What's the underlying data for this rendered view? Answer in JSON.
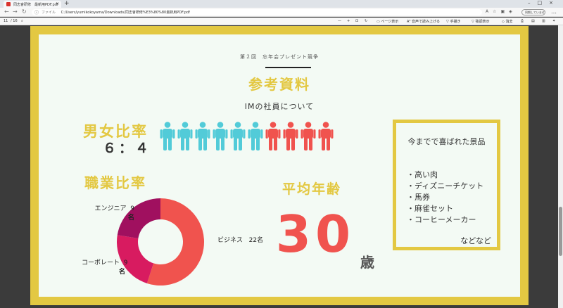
{
  "browser": {
    "tab_title": "同志會研修　最新用PDF.pdf",
    "tab_close": "×",
    "new_tab": "+",
    "window_controls": "–□×",
    "nav_back": "←",
    "nav_forward": "→",
    "nav_reload": "↻",
    "url_label": "ファイル",
    "url": "C:/Users/yumikokoyama/Downloads/同志會研修%E3%80%80最新用PDF.pdf",
    "profile_label": "同期していません",
    "more": "…"
  },
  "pdf_toolbar": {
    "page_current": "11",
    "page_total": "/ 16",
    "zoom_minus": "—",
    "zoom_plus": "+",
    "page_view": "ページ表示",
    "read_aloud": "音声で読み上げる",
    "draw": "手描き",
    "highlight": "強調表示",
    "erase": "消去"
  },
  "slide": {
    "subtitle": "第２回　忘年会プレゼント競争",
    "title": "参考資料",
    "intro": "IMの社員について",
    "gender": {
      "title": "男女比率",
      "ratio": "６：４",
      "male_count": 6,
      "female_count": 4,
      "male_color": "#52cbd8",
      "female_color": "#f0534e"
    },
    "occupation": {
      "title": "職業比率",
      "segments": [
        {
          "label": "ビジネス",
          "count_label": "22名",
          "value": 22,
          "color": "#f0534e"
        },
        {
          "label": "コーポレート",
          "count_label": "9",
          "unit": "名",
          "value": 9,
          "color": "#d81b60"
        },
        {
          "label": "エンジニア",
          "count_label": "9",
          "unit": "名",
          "value": 9,
          "color": "#a0105f"
        }
      ]
    },
    "age": {
      "title": "平均年齢",
      "value": "30",
      "unit": "歳",
      "color": "#f0534e"
    },
    "prizes": {
      "title": "今までで喜ばれた景品",
      "items": [
        "・高い肉",
        "・ディズニーチケット",
        "・馬券",
        "・麻雀セット",
        "・コーヒーメーカー"
      ],
      "footer": "などなど",
      "border_color": "#e3c842"
    }
  }
}
